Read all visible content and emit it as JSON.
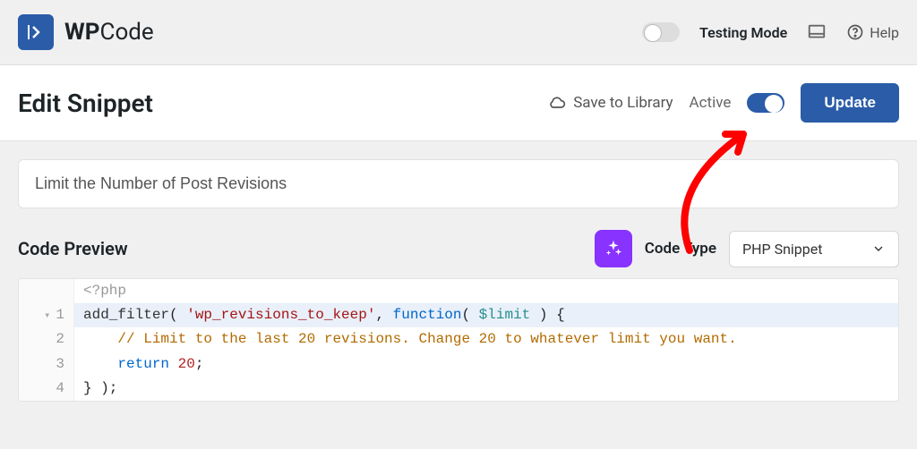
{
  "brand": {
    "name_bold": "WP",
    "name_thin": "Code"
  },
  "topbar": {
    "testing_mode_label": "Testing Mode",
    "testing_mode_on": false,
    "help_label": "Help"
  },
  "titlebar": {
    "heading": "Edit Snippet",
    "save_to_library": "Save to Library",
    "active_label": "Active",
    "active_on": true,
    "update_label": "Update"
  },
  "snippet": {
    "title": "Limit the Number of Post Revisions"
  },
  "preview": {
    "heading": "Code Preview",
    "code_type_label": "Code Type",
    "code_type_value": "PHP Snippet"
  },
  "code": {
    "php_open": "<?php",
    "line1": {
      "fn1": "add_filter",
      "paren1": "( ",
      "str": "'wp_revisions_to_keep'",
      "comma": ", ",
      "kw": "function",
      "paren2": "( ",
      "var": "$limit",
      "tail": " ) {"
    },
    "line2": {
      "indent": "    ",
      "comment": "// Limit to the last 20 revisions. Change 20 to whatever limit you want."
    },
    "line3": {
      "indent": "    ",
      "kw": "return",
      "sp": " ",
      "num": "20",
      "semi": ";"
    },
    "line4": {
      "text": "} );"
    },
    "ln": {
      "l1": "1",
      "l2": "2",
      "l3": "3",
      "l4": "4"
    }
  }
}
